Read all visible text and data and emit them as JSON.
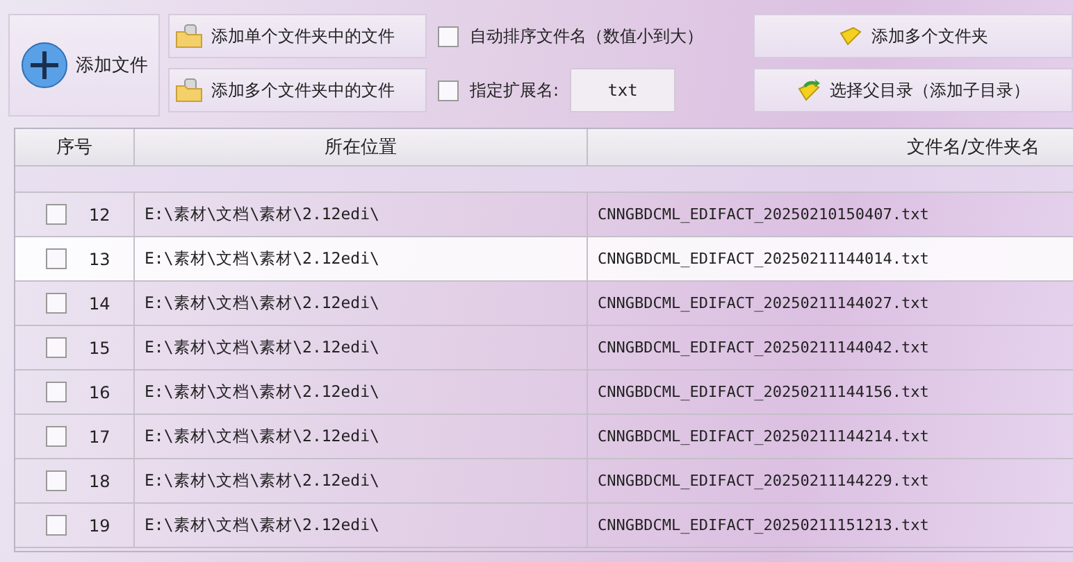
{
  "toolbar": {
    "add_file_button": "添加文件",
    "folder_buttons": [
      "添加单个文件夹中的文件",
      "添加多个文件夹中的文件"
    ],
    "auto_sort": {
      "label": "自动排序文件名（数值小到大）",
      "checked": false
    },
    "extension_filter": {
      "label": "指定扩展名:",
      "checked": false,
      "value": "txt"
    },
    "right_buttons": [
      {
        "label": "添加多个文件夹",
        "kind": "folder"
      },
      {
        "label": "选择父目录（添加子目录）",
        "kind": "parent"
      }
    ]
  },
  "table": {
    "columns": [
      "序号",
      "所在位置",
      "文件名/文件夹名"
    ],
    "rows": [
      {
        "index": "12",
        "location": "E:\\素材\\文档\\素材\\2.12edi\\",
        "name": "CNNGBDCML_EDIFACT_20250210150407.txt",
        "checked": false,
        "selected": false
      },
      {
        "index": "13",
        "location": "E:\\素材\\文档\\素材\\2.12edi\\",
        "name": "CNNGBDCML_EDIFACT_20250211144014.txt",
        "checked": false,
        "selected": true
      },
      {
        "index": "14",
        "location": "E:\\素材\\文档\\素材\\2.12edi\\",
        "name": "CNNGBDCML_EDIFACT_20250211144027.txt",
        "checked": false,
        "selected": false
      },
      {
        "index": "15",
        "location": "E:\\素材\\文档\\素材\\2.12edi\\",
        "name": "CNNGBDCML_EDIFACT_20250211144042.txt",
        "checked": false,
        "selected": false
      },
      {
        "index": "16",
        "location": "E:\\素材\\文档\\素材\\2.12edi\\",
        "name": "CNNGBDCML_EDIFACT_20250211144156.txt",
        "checked": false,
        "selected": false
      },
      {
        "index": "17",
        "location": "E:\\素材\\文档\\素材\\2.12edi\\",
        "name": "CNNGBDCML_EDIFACT_20250211144214.txt",
        "checked": false,
        "selected": false
      },
      {
        "index": "18",
        "location": "E:\\素材\\文档\\素材\\2.12edi\\",
        "name": "CNNGBDCML_EDIFACT_20250211144229.txt",
        "checked": false,
        "selected": false
      },
      {
        "index": "19",
        "location": "E:\\素材\\文档\\素材\\2.12edi\\",
        "name": "CNNGBDCML_EDIFACT_20250211151213.txt",
        "checked": false,
        "selected": false
      }
    ]
  }
}
